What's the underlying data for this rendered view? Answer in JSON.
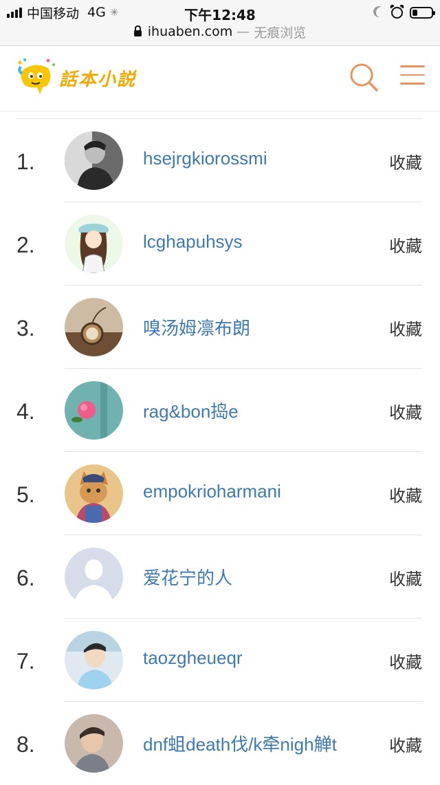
{
  "status_bar": {
    "carrier": "中国移动",
    "network": "4G",
    "time": "下午12:48"
  },
  "address_bar": {
    "domain": "ihuaben.com",
    "separator": "—",
    "mode": "无痕浏览"
  },
  "header": {
    "logo_text": "話本小説",
    "search_icon": "search-icon",
    "menu_icon": "hamburger-menu-icon",
    "accent_color": "#e8935c",
    "brand_color": "#f2a900"
  },
  "list": {
    "link_color": "#3d7ab3",
    "rows": [
      {
        "rank": "1.",
        "name": "hsejrgkiorossmi",
        "action": "收藏"
      },
      {
        "rank": "2.",
        "name": "lcghapuhsys",
        "action": "收藏"
      },
      {
        "rank": "3.",
        "name": "嗅汤姆凛布朗",
        "action": "收藏"
      },
      {
        "rank": "4.",
        "name": "rag&bon捣e",
        "action": "收藏"
      },
      {
        "rank": "5.",
        "name": "empokrioharmani",
        "action": "收藏"
      },
      {
        "rank": "6.",
        "name": "爱花宁的人",
        "action": "收藏"
      },
      {
        "rank": "7.",
        "name": "taozgheueqr",
        "action": "收藏"
      },
      {
        "rank": "8.",
        "name": "dnf蛆death伐/k牵nigh觯t",
        "action": "收藏"
      }
    ]
  }
}
